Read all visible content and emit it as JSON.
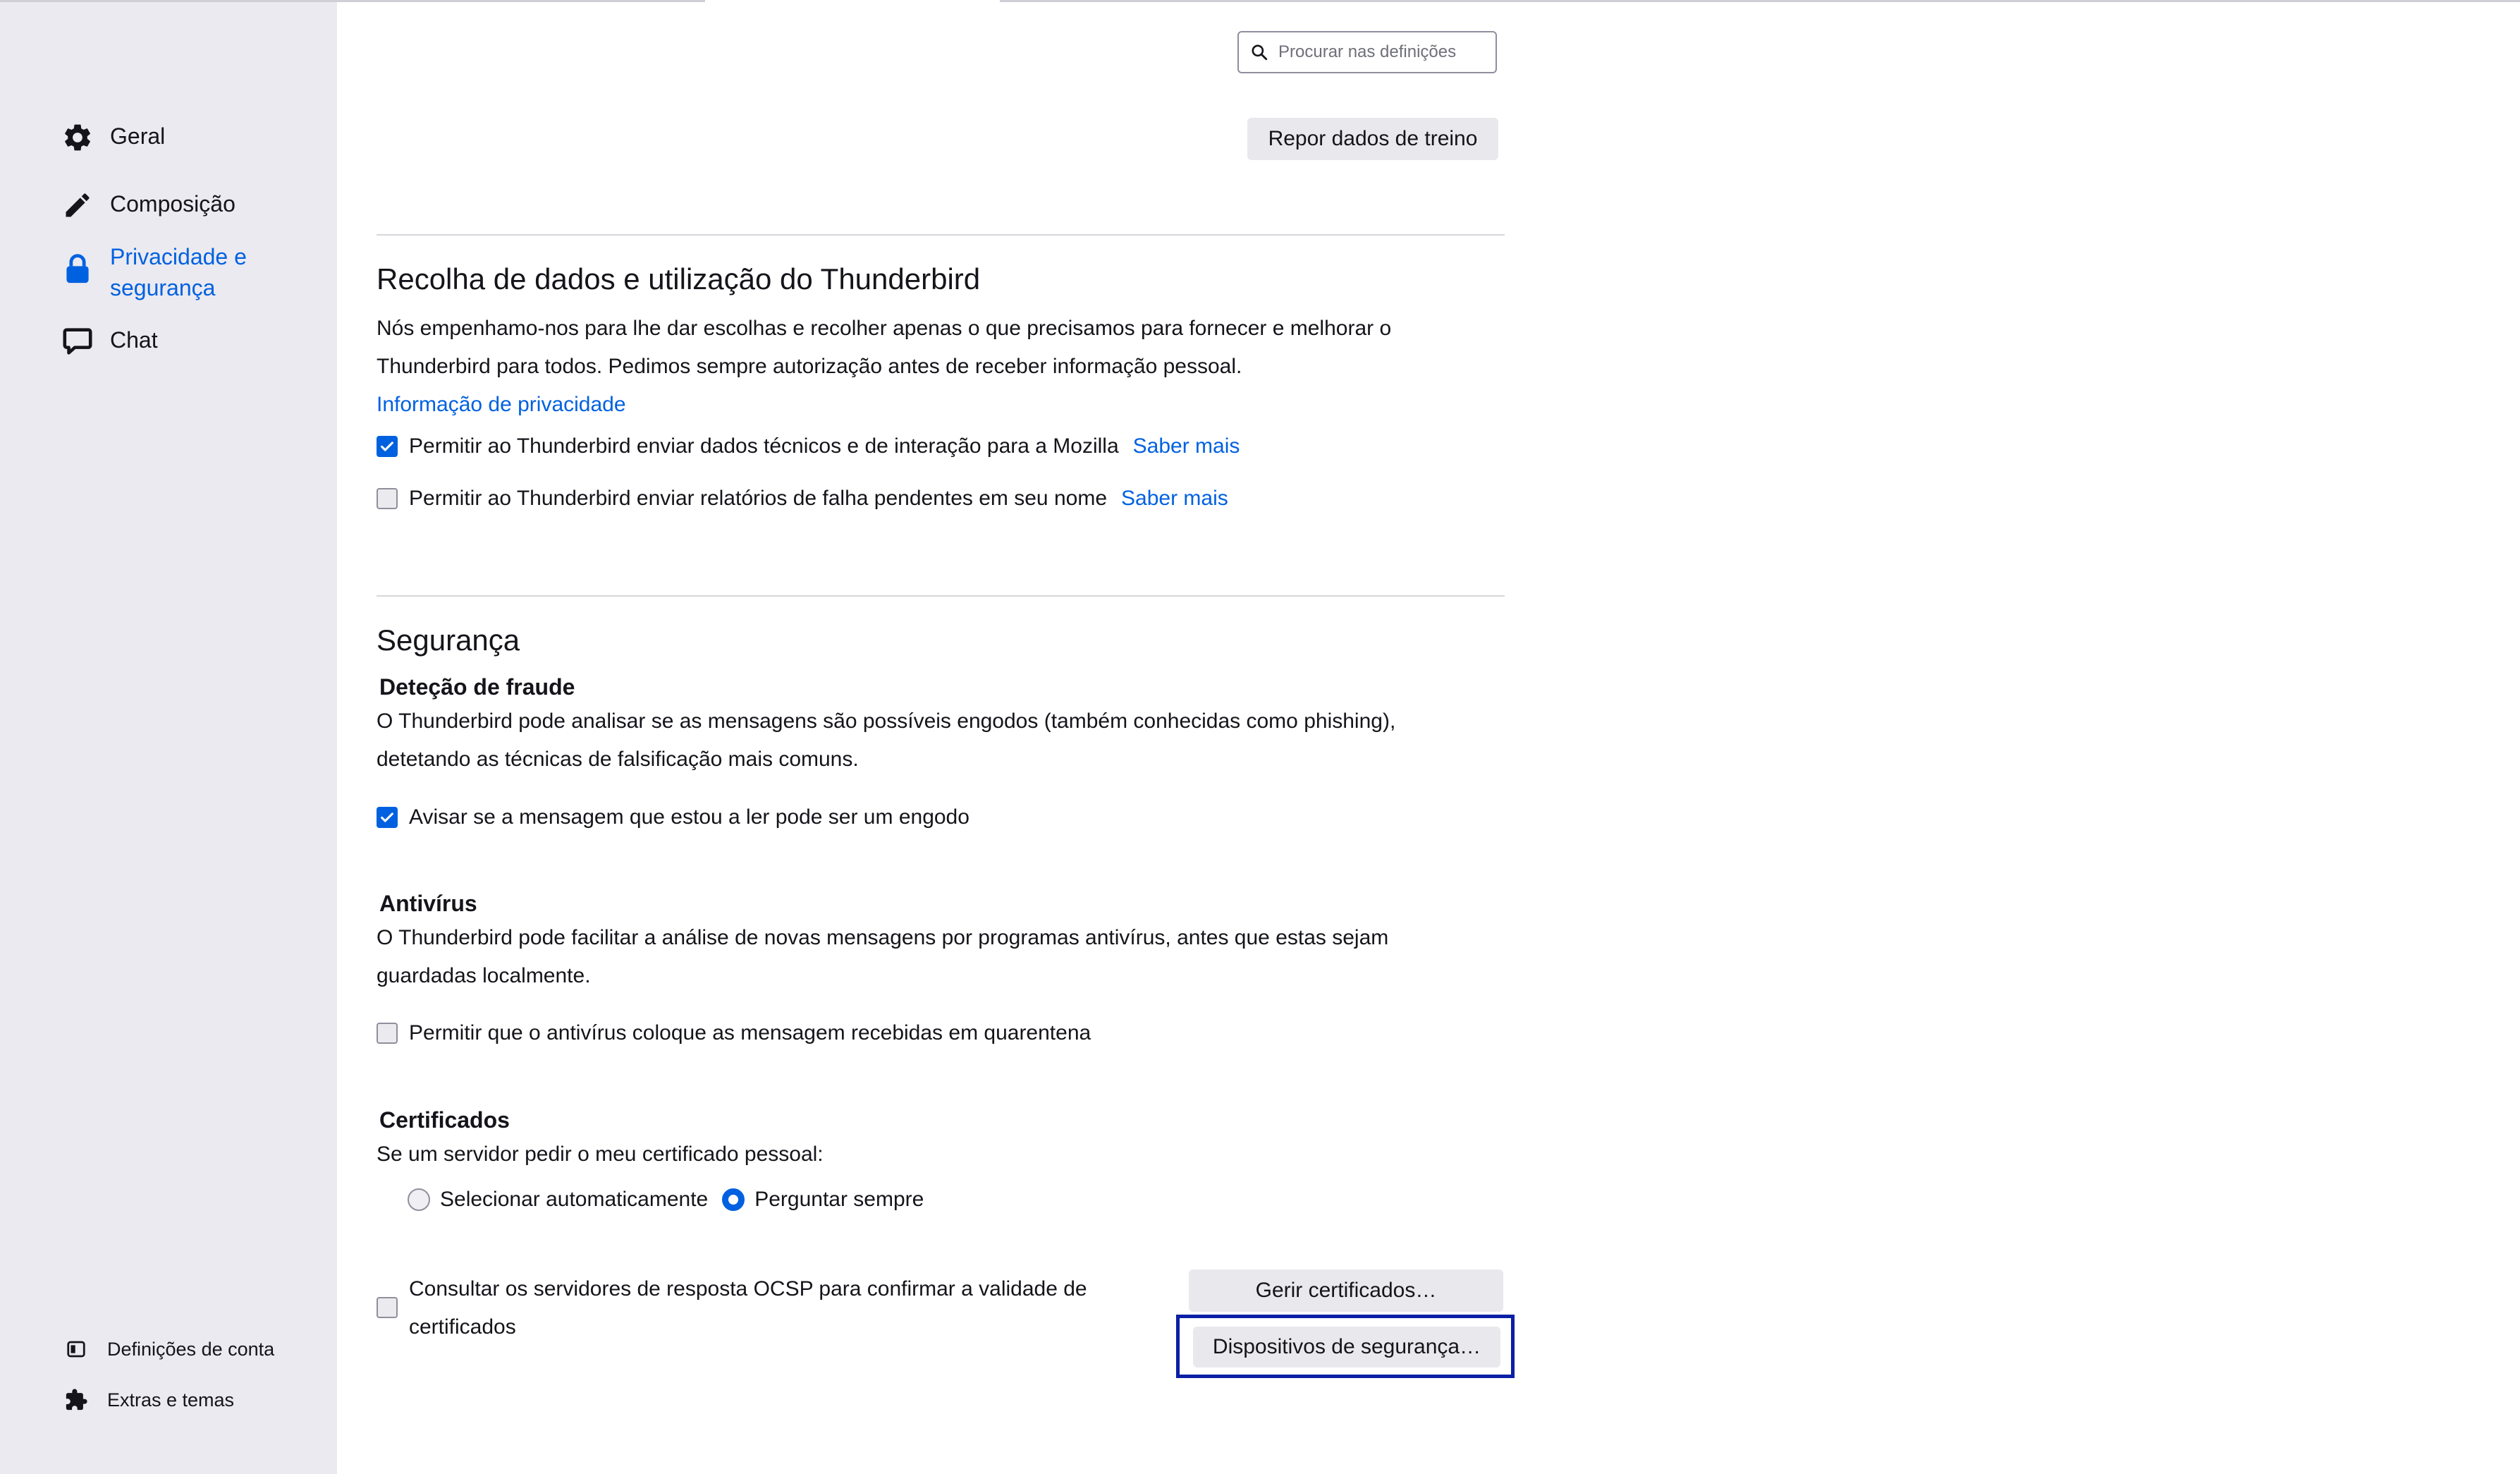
{
  "sidebar": {
    "items": [
      {
        "label": "Geral",
        "icon": "gear-icon"
      },
      {
        "label": "Composição",
        "icon": "pencil-icon"
      },
      {
        "label_line1": "Privacidade e",
        "label_line2": "segurança",
        "icon": "lock-icon",
        "active": true
      },
      {
        "label": "Chat",
        "icon": "chat-icon"
      }
    ],
    "footer": [
      {
        "label": "Definições de conta",
        "icon": "account-settings-icon"
      },
      {
        "label": "Extras e temas",
        "icon": "puzzle-icon"
      }
    ]
  },
  "search": {
    "placeholder": "Procurar nas definições",
    "value": ""
  },
  "training": {
    "reset_button": "Repor dados de treino"
  },
  "data_collection": {
    "title": "Recolha de dados e utilização do Thunderbird",
    "description_line1": "Nós empenhamo-nos para lhe dar escolhas e recolher apenas o que precisamos para fornecer e melhorar o",
    "description_line2": "Thunderbird para todos. Pedimos sempre autorização antes de receber informação pessoal.",
    "privacy_link": "Informação de privacidade",
    "options": [
      {
        "label": "Permitir ao Thunderbird enviar dados técnicos e de interação para a Mozilla",
        "link": "Saber mais",
        "checked": true
      },
      {
        "label": "Permitir ao Thunderbird enviar relatórios de falha pendentes em seu nome",
        "link": "Saber mais",
        "checked": false
      }
    ]
  },
  "security": {
    "title": "Segurança",
    "fraud": {
      "title": "Deteção de fraude",
      "line1": "O Thunderbird pode analisar se as mensagens são possíveis engodos (também conhecidas como phishing),",
      "line2": "detetando as técnicas de falsificação mais comuns.",
      "option": {
        "label": "Avisar se a mensagem que estou a ler pode ser um engodo",
        "checked": true
      }
    },
    "antivirus": {
      "title": "Antivírus",
      "line1": "O Thunderbird pode facilitar a análise de novas mensagens por programas antivírus, antes que estas sejam",
      "line2": "guardadas localmente.",
      "option": {
        "label": "Permitir que o antivírus coloque as mensagem recebidas em quarentena",
        "checked": false
      }
    },
    "certificates": {
      "title": "Certificados",
      "prompt": "Se um servidor pedir o meu certificado pessoal:",
      "radio_auto": "Selecionar automaticamente",
      "radio_ask": "Perguntar sempre",
      "selected": "Perguntar sempre",
      "ocsp_line1": "Consultar os servidores de resposta OCSP para confirmar a validade de",
      "ocsp_line2": "certificados",
      "ocsp_checked": false,
      "manage_button": "Gerir certificados…",
      "devices_button": "Dispositivos de segurança…"
    }
  },
  "colors": {
    "accent": "#0061e0",
    "sidebar_bg": "#ebeaf0",
    "button_bg": "#e9e9ed",
    "focus_outline": "#0a1fa5"
  }
}
